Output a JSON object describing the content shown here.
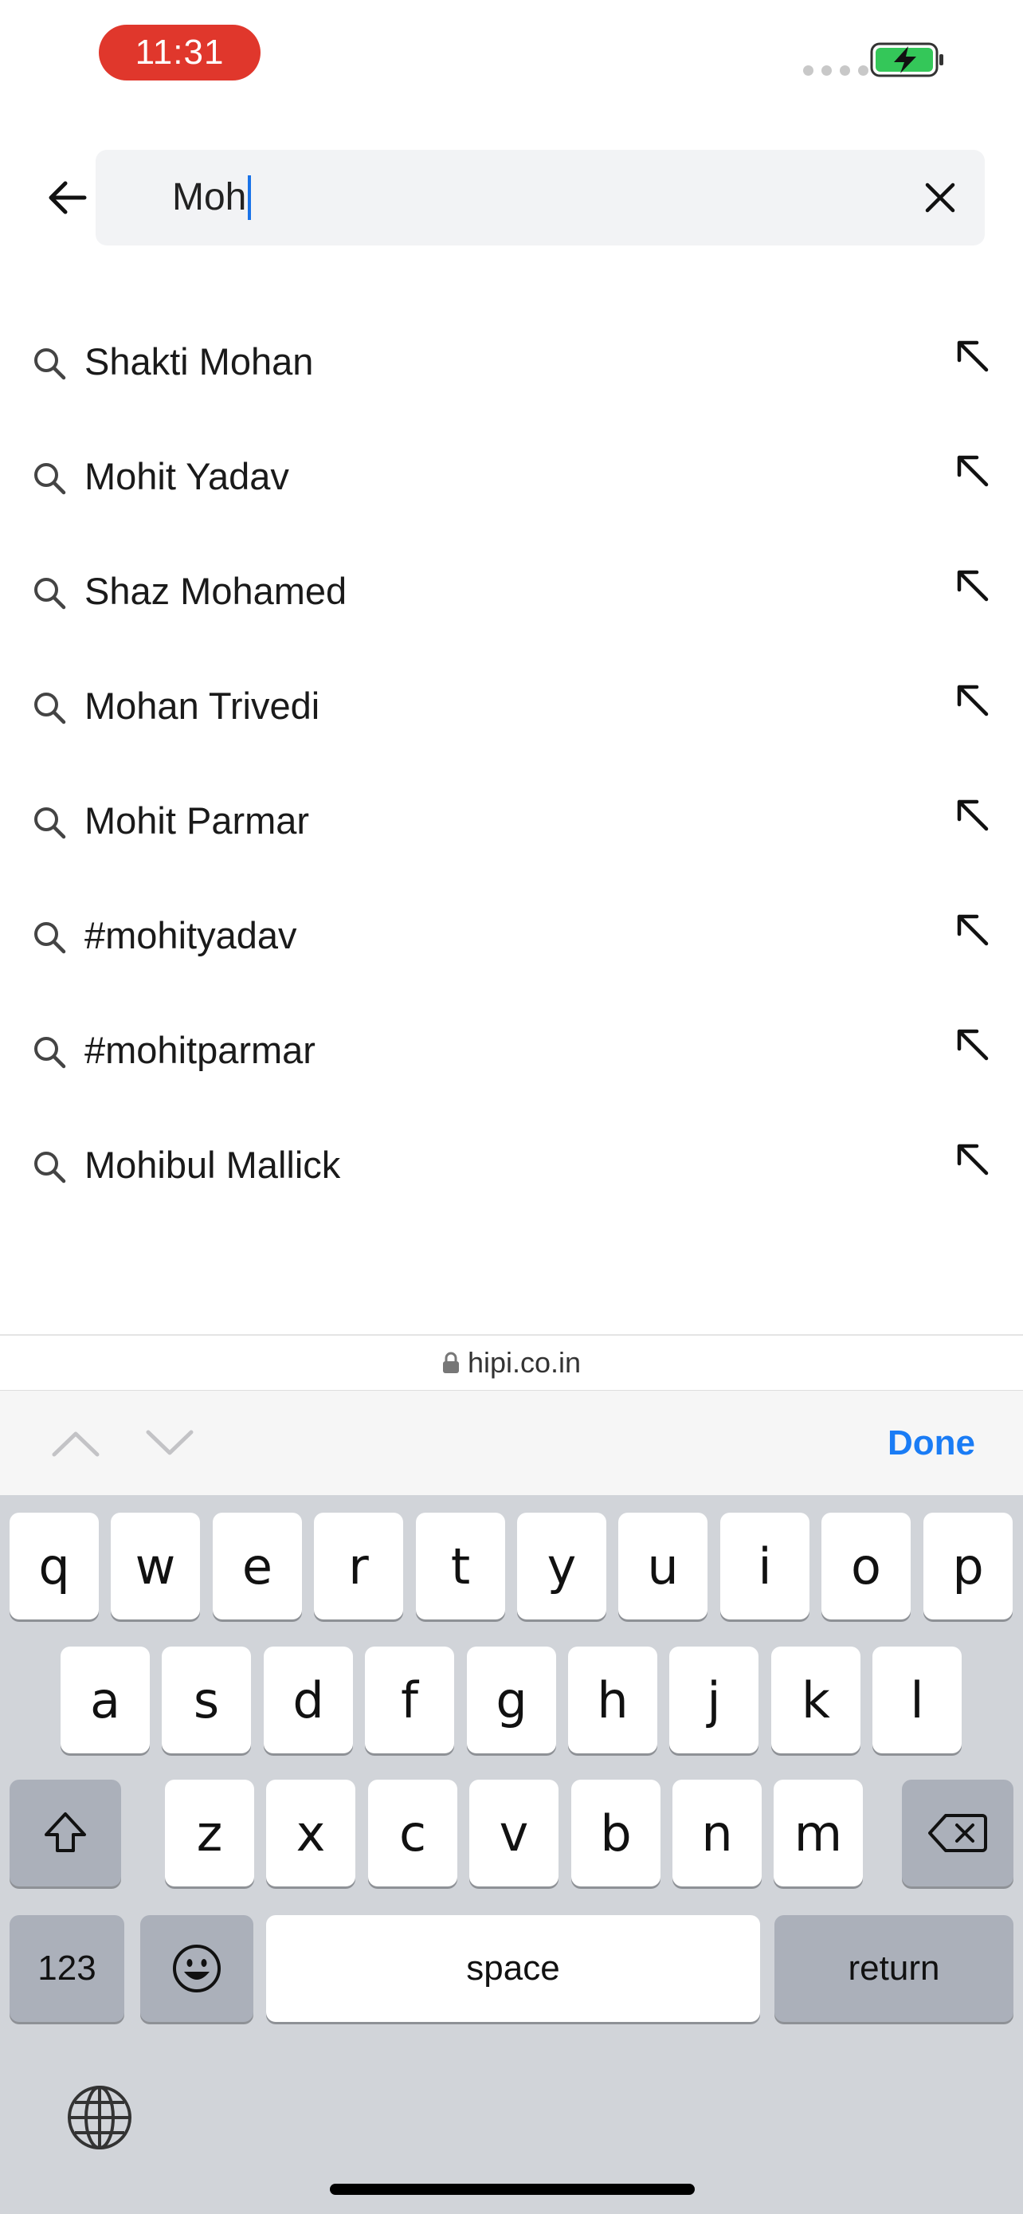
{
  "status_bar": {
    "time": "11:31"
  },
  "search": {
    "query": "Moh"
  },
  "suggestions": [
    {
      "label": "Shakti Mohan"
    },
    {
      "label": "Mohit Yadav"
    },
    {
      "label": "Shaz Mohamed"
    },
    {
      "label": "Mohan Trivedi"
    },
    {
      "label": "Mohit Parmar"
    },
    {
      "label": "#mohityadav"
    },
    {
      "label": "#mohitparmar"
    },
    {
      "label": "Mohibul Mallick"
    }
  ],
  "url_bar": {
    "domain": "hipi.co.in"
  },
  "accessory": {
    "done_label": "Done"
  },
  "keyboard": {
    "row1": [
      "q",
      "w",
      "e",
      "r",
      "t",
      "y",
      "u",
      "i",
      "o",
      "p"
    ],
    "row2": [
      "a",
      "s",
      "d",
      "f",
      "g",
      "h",
      "j",
      "k",
      "l"
    ],
    "row3": [
      "z",
      "x",
      "c",
      "v",
      "b",
      "n",
      "m"
    ],
    "numbers_label": "123",
    "space_label": "space",
    "return_label": "return"
  },
  "colors": {
    "time_pill": "#e0372c",
    "accent": "#1a7cf5",
    "battery_fill": "#34c759"
  },
  "icons": {
    "back": "arrow-left-icon",
    "clear": "close-icon",
    "suggestion": "search-icon",
    "fill": "arrow-up-left-icon",
    "lock": "lock-icon",
    "prev": "chevron-up-icon",
    "next": "chevron-down-icon",
    "shift": "shift-icon",
    "delete": "backspace-icon",
    "emoji": "emoji-icon",
    "globe": "globe-icon"
  }
}
